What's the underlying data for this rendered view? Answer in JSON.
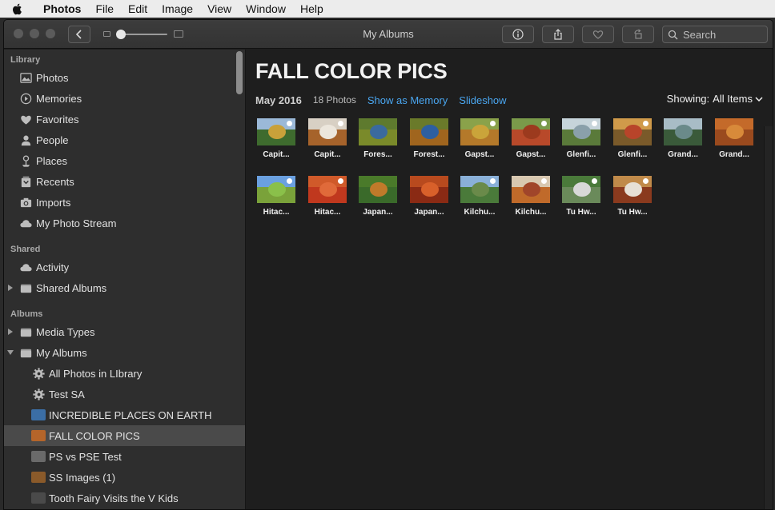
{
  "menubar": {
    "app": "Photos",
    "items": [
      "File",
      "Edit",
      "Image",
      "View",
      "Window",
      "Help"
    ]
  },
  "window": {
    "title": "My Albums",
    "search_placeholder": "Search"
  },
  "sidebar": {
    "library_header": "Library",
    "library": [
      {
        "label": "Photos",
        "icon": "photos-icon"
      },
      {
        "label": "Memories",
        "icon": "memories-icon"
      },
      {
        "label": "Favorites",
        "icon": "heart-icon"
      },
      {
        "label": "People",
        "icon": "person-icon"
      },
      {
        "label": "Places",
        "icon": "pin-icon"
      },
      {
        "label": "Recents",
        "icon": "recents-icon"
      },
      {
        "label": "Imports",
        "icon": "camera-icon"
      },
      {
        "label": "My Photo Stream",
        "icon": "cloud-icon"
      }
    ],
    "shared_header": "Shared",
    "shared": [
      {
        "label": "Activity",
        "icon": "cloud-icon"
      },
      {
        "label": "Shared Albums",
        "icon": "folder-icon"
      }
    ],
    "albums_header": "Albums",
    "albums": [
      {
        "label": "Media Types",
        "icon": "folder-icon"
      },
      {
        "label": "My Albums",
        "icon": "folder-icon"
      }
    ],
    "my_albums": [
      {
        "label": "All Photos in LIbrary",
        "icon": "gear-icon"
      },
      {
        "label": "Test SA",
        "icon": "gear-icon"
      },
      {
        "label": "INCREDIBLE PLACES ON EARTH",
        "icon": "album-thumb-icon",
        "color": "#3b6ea5"
      },
      {
        "label": "FALL COLOR PICS",
        "icon": "album-thumb-icon",
        "color": "#b5652a"
      },
      {
        "label": "PS vs PSE Test",
        "icon": "album-thumb-icon",
        "color": "#6a6a6a"
      },
      {
        "label": "SS Images (1)",
        "icon": "album-thumb-icon",
        "color": "#8a5a2a"
      },
      {
        "label": "Tooth Fairy Visits the V Kids",
        "icon": "album-thumb-icon",
        "color": "#4a4a4a"
      }
    ]
  },
  "main": {
    "album_title": "FALL COLOR PICS",
    "date": "May 2016",
    "count": "18 Photos",
    "show_as_memory": "Show as Memory",
    "slideshow": "Slideshow",
    "showing_label": "Showing:",
    "showing_value": "All Items",
    "photos": [
      {
        "caption": "Capit...",
        "sky": "#9bb9d8",
        "ground": "#3e6b2e",
        "blob": "#c9a13a",
        "pin": true
      },
      {
        "caption": "Capit...",
        "sky": "#d8d0c4",
        "ground": "#a6632b",
        "blob": "#ece6dc",
        "pin": true
      },
      {
        "caption": "Fores...",
        "sky": "#5e7a2e",
        "ground": "#7a8a2a",
        "blob": "#3a6a9e",
        "pin": false
      },
      {
        "caption": "Forest...",
        "sky": "#6a7a2a",
        "ground": "#a0651e",
        "blob": "#2d5fa0",
        "pin": false
      },
      {
        "caption": "Gapst...",
        "sky": "#8aa24a",
        "ground": "#b4792a",
        "blob": "#caa43a",
        "pin": true
      },
      {
        "caption": "Gapst...",
        "sky": "#7a9a4a",
        "ground": "#b8492a",
        "blob": "#9c3a1e",
        "pin": true
      },
      {
        "caption": "Glenfi...",
        "sky": "#c6d4da",
        "ground": "#5a7a3a",
        "blob": "#8aa0aa",
        "pin": true
      },
      {
        "caption": "Glenfi...",
        "sky": "#d09a4a",
        "ground": "#7a5a2a",
        "blob": "#b8442a",
        "pin": true
      },
      {
        "caption": "Grand...",
        "sky": "#a8bcc6",
        "ground": "#3a5a3a",
        "blob": "#6a8a8a",
        "pin": false
      },
      {
        "caption": "Grand...",
        "sky": "#c46a2a",
        "ground": "#9a4a1e",
        "blob": "#d88a3a",
        "pin": false
      },
      {
        "caption": "Hitac...",
        "sky": "#6aa0e0",
        "ground": "#7aa23a",
        "blob": "#8ac04a",
        "pin": true
      },
      {
        "caption": "Hitac...",
        "sky": "#d05a2a",
        "ground": "#c0381e",
        "blob": "#e06a3a",
        "pin": true
      },
      {
        "caption": "Japan...",
        "sky": "#4a7a2a",
        "ground": "#3a6a2a",
        "blob": "#c07a2a",
        "pin": false
      },
      {
        "caption": "Japan...",
        "sky": "#b84a1e",
        "ground": "#8a2a14",
        "blob": "#d8602a",
        "pin": false
      },
      {
        "caption": "Kilchu...",
        "sky": "#8ab0d8",
        "ground": "#4a7a3a",
        "blob": "#6a8a4a",
        "pin": true
      },
      {
        "caption": "Kilchu...",
        "sky": "#d8c8b0",
        "ground": "#c06a2a",
        "blob": "#a0452a",
        "pin": true
      },
      {
        "caption": "Tu Hw...",
        "sky": "#4a7a3a",
        "ground": "#6a8a5a",
        "blob": "#d8d8d8",
        "pin": true
      },
      {
        "caption": "Tu Hw...",
        "sky": "#c08a4a",
        "ground": "#8a3a1e",
        "blob": "#e6e0d6",
        "pin": true
      }
    ]
  }
}
